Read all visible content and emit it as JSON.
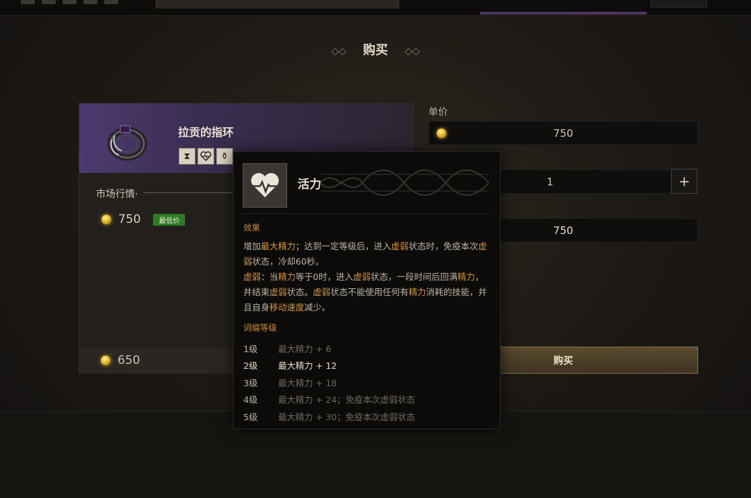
{
  "page": {
    "title": "购买"
  },
  "item": {
    "name": "拉贡的指环",
    "attr_icons": [
      "hourglass-icon",
      "heart-pulse-icon",
      "bottle-icon"
    ]
  },
  "market": {
    "label": "市场行情",
    "price": "750",
    "lowest_badge": "最低价"
  },
  "bottom_price": "650",
  "form": {
    "unit_price_label": "单价",
    "unit_price": "750",
    "quantity": "1",
    "plus_label": "+",
    "total": "750",
    "buy_label": "购买"
  },
  "tooltip": {
    "name": "活力",
    "effect_label": "效果",
    "desc": [
      [
        [
          "增加",
          false
        ],
        [
          "最大精力",
          true
        ],
        [
          "；达到一定等级后，进入",
          false
        ],
        [
          "虚弱",
          true
        ],
        [
          "状态时，免疫本次",
          false
        ],
        [
          "虚弱",
          true
        ],
        [
          "状态，冷却60秒。",
          false
        ]
      ],
      [
        [
          "虚弱",
          true
        ],
        [
          "：当",
          false
        ],
        [
          "精力",
          true
        ],
        [
          "等于0时，进入",
          false
        ],
        [
          "虚弱",
          true
        ],
        [
          "状态，一段时间后回满",
          false
        ],
        [
          "精力",
          true
        ],
        [
          "，并结束",
          false
        ],
        [
          "虚弱",
          true
        ],
        [
          "状态。",
          false
        ],
        [
          "虚弱",
          true
        ],
        [
          "状态不能使用任何有",
          false
        ],
        [
          "精力",
          true
        ],
        [
          "消耗的技能，并且自身",
          false
        ],
        [
          "移动速度",
          true
        ],
        [
          "减少。",
          false
        ]
      ]
    ],
    "levels_label": "词缀等级",
    "levels": [
      {
        "level": "1级",
        "effect": "最大精力 + 6",
        "active": false
      },
      {
        "level": "2级",
        "effect": "最大精力 + 12",
        "active": true
      },
      {
        "level": "3级",
        "effect": "最大精力 + 18",
        "active": false
      },
      {
        "level": "4级",
        "effect": "最大精力 + 24；免疫本次虚弱状态",
        "active": false
      },
      {
        "level": "5级",
        "effect": "最大精力 + 30；免疫本次虚弱状态",
        "active": false
      }
    ]
  },
  "colors": {
    "accent": "#d0953c",
    "purple_header": "#4d3a6e",
    "lowest_badge": "#2f7a26"
  }
}
